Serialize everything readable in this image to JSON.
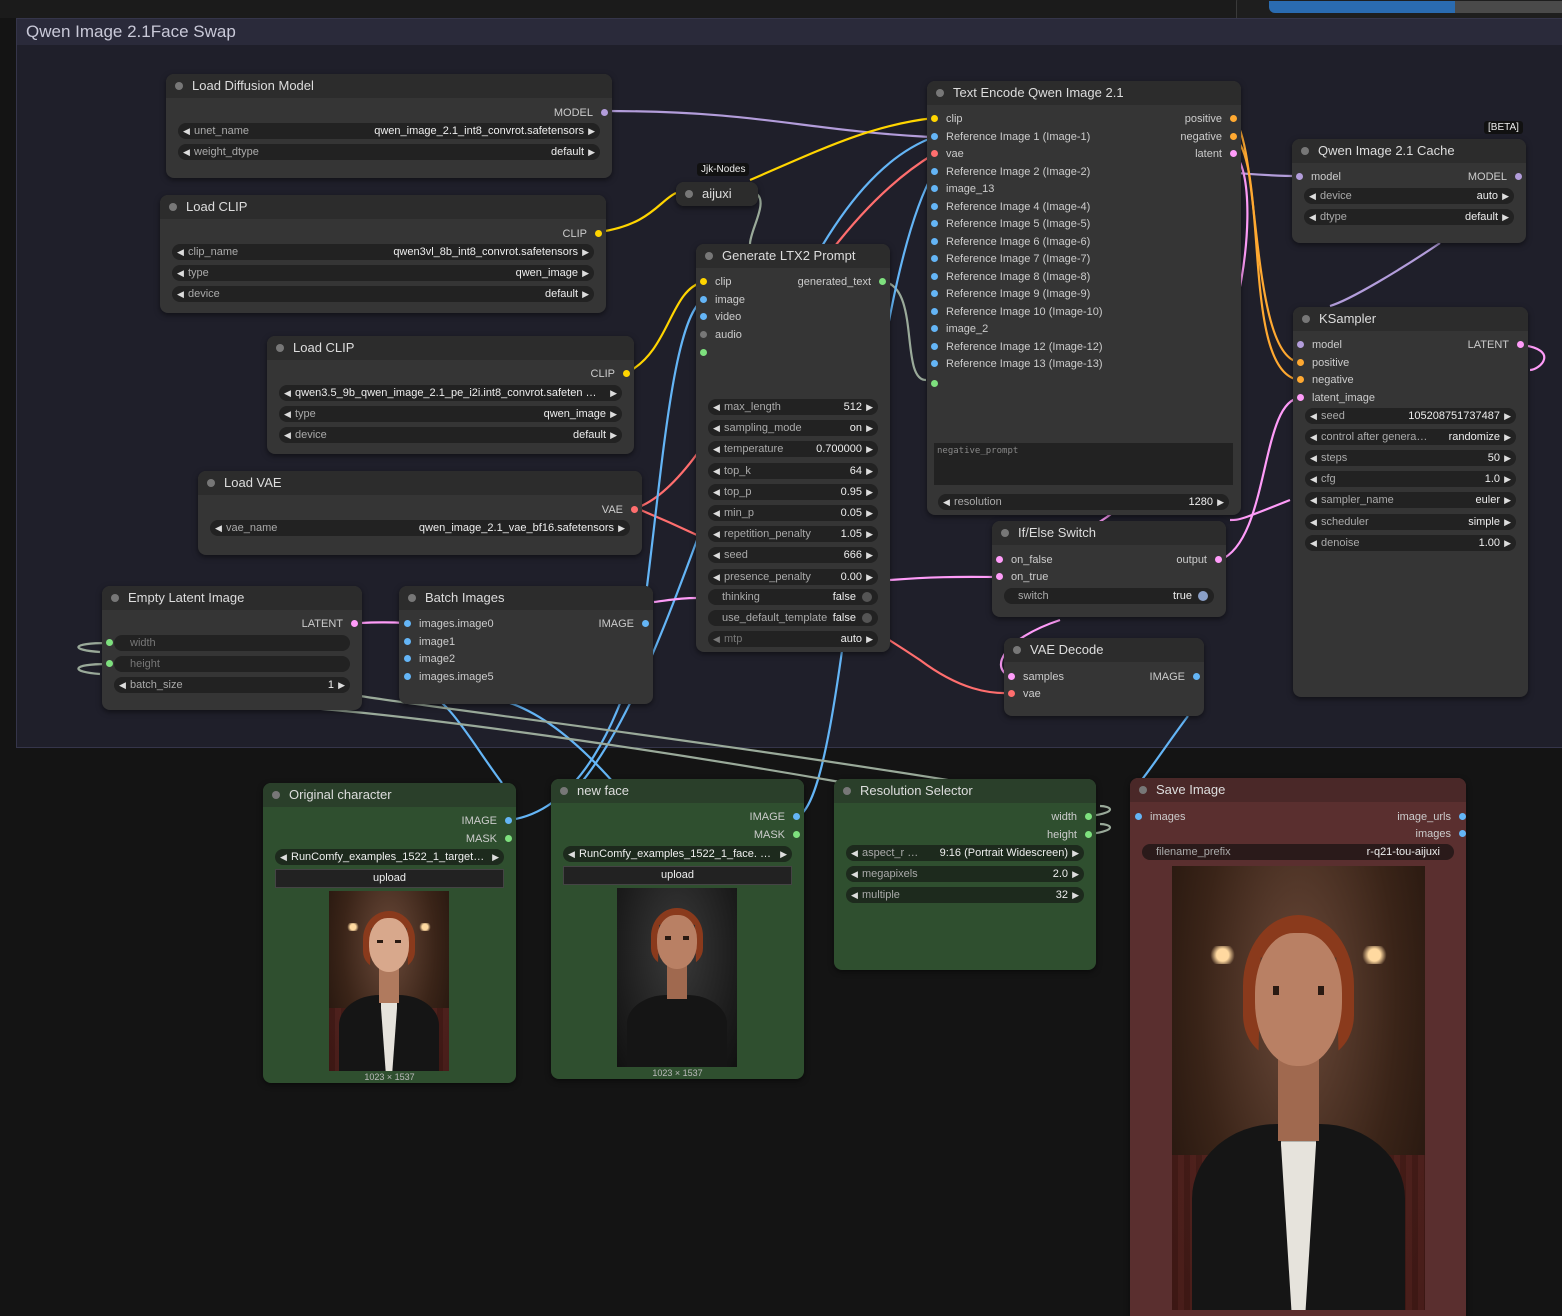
{
  "group": {
    "title": "Qwen Image 2.1Face Swap"
  },
  "badges": {
    "jjk": "Jjk-Nodes",
    "beta": "[BETA]"
  },
  "nodes": {
    "load_diffusion": {
      "title": "Load Diffusion Model",
      "out_model": "MODEL",
      "unet_name_label": "unet_name",
      "unet_name": "qwen_image_2.1_int8_convrot.safetensors",
      "weight_dtype_label": "weight_dtype",
      "weight_dtype": "default"
    },
    "load_clip1": {
      "title": "Load CLIP",
      "out_clip": "CLIP",
      "clip_name_label": "clip_name",
      "clip_name": "qwen3vl_8b_int8_convrot.safetensors",
      "type_label": "type",
      "type": "qwen_image",
      "device_label": "device",
      "device": "default"
    },
    "load_clip2": {
      "title": "Load CLIP",
      "out_clip": "CLIP",
      "clip_name": "qwen3.5_9b_qwen_image_2.1_pe_i2i.int8_convrot.safeten  …",
      "type_label": "type",
      "type": "qwen_image",
      "device_label": "device",
      "device": "default"
    },
    "load_vae": {
      "title": "Load VAE",
      "out_vae": "VAE",
      "vae_name_label": "vae_name",
      "vae_name": "qwen_image_2.1_vae_bf16.safetensors"
    },
    "empty_latent": {
      "title": "Empty Latent Image",
      "out_latent": "LATENT",
      "width_label": "width",
      "height_label": "height",
      "batch_label": "batch_size",
      "batch_size": "1"
    },
    "batch_images": {
      "title": "Batch Images",
      "out_image": "IMAGE",
      "inputs": [
        "images.image0",
        "image1",
        "image2",
        "images.image5"
      ]
    },
    "aijuxi": {
      "title": "aijuxi"
    },
    "ltx2": {
      "title": "Generate LTX2 Prompt",
      "out_text": "generated_text",
      "inputs": [
        "clip",
        "image",
        "video",
        "audio"
      ],
      "widgets": [
        {
          "label": "max_length",
          "value": "512"
        },
        {
          "label": "sampling_mode",
          "value": "on"
        },
        {
          "label": "temperature",
          "value": "0.700000"
        },
        {
          "label": "top_k",
          "value": "64"
        },
        {
          "label": "top_p",
          "value": "0.95"
        },
        {
          "label": "min_p",
          "value": "0.05"
        },
        {
          "label": "repetition_penalty",
          "value": "1.05"
        },
        {
          "label": "seed",
          "value": "666"
        },
        {
          "label": "presence_penalty",
          "value": "0.00"
        }
      ],
      "thinking_label": "thinking",
      "thinking": "false",
      "udt_label": "use_default_template",
      "udt": "false",
      "mtp_label": "mtp",
      "mtp": "auto"
    },
    "text_encode": {
      "title": "Text Encode Qwen Image 2.1",
      "inputs": [
        "clip",
        "Reference Image 1 (Image-1)",
        "vae",
        "Reference Image 2 (Image-2)",
        "image_13",
        "Reference Image 4 (Image-4)",
        "Reference Image 5 (Image-5)",
        "Reference Image 6 (Image-6)",
        "Reference Image 7 (Image-7)",
        "Reference Image 8 (Image-8)",
        "Reference Image 9 (Image-9)",
        "Reference Image 10 (Image-10)",
        "image_2",
        "Reference Image 12 (Image-12)",
        "Reference Image 13 (Image-13)"
      ],
      "outputs": [
        "positive",
        "negative",
        "latent"
      ],
      "negative_placeholder": "negative_prompt",
      "resolution_label": "resolution",
      "resolution": "1280"
    },
    "cache": {
      "title": "Qwen Image 2.1 Cache",
      "in_model": "model",
      "out_model": "MODEL",
      "device_label": "device",
      "device": "auto",
      "dtype_label": "dtype",
      "dtype": "default"
    },
    "ksampler": {
      "title": "KSampler",
      "inputs": [
        "model",
        "positive",
        "negative",
        "latent_image"
      ],
      "out_latent": "LATENT",
      "widgets": [
        {
          "label": "seed",
          "value": "105208751737487"
        },
        {
          "label": "control after genera…",
          "value": "randomize"
        },
        {
          "label": "steps",
          "value": "50"
        },
        {
          "label": "cfg",
          "value": "1.0"
        },
        {
          "label": "sampler_name",
          "value": "euler"
        },
        {
          "label": "scheduler",
          "value": "simple"
        },
        {
          "label": "denoise",
          "value": "1.00"
        }
      ]
    },
    "ifelse": {
      "title": "If/Else Switch",
      "inputs": [
        "on_false",
        "on_true"
      ],
      "out": "output",
      "switch_label": "switch",
      "switch": "true"
    },
    "vae_decode": {
      "title": "VAE Decode",
      "inputs": [
        "samples",
        "vae"
      ],
      "out": "IMAGE"
    },
    "original": {
      "title": "Original character",
      "outs": [
        "IMAGE",
        "MASK"
      ],
      "image": "RunComfy_examples_1522_1_target…",
      "upload": "upload",
      "dims": "1023 × 1537"
    },
    "newface": {
      "title": "new face",
      "outs": [
        "IMAGE",
        "MASK"
      ],
      "image": "RunComfy_examples_1522_1_face.  …",
      "upload": "upload",
      "dims": "1023 × 1537"
    },
    "resolution": {
      "title": "Resolution Selector",
      "outs": [
        "width",
        "height"
      ],
      "aspect_label": "aspect_r  …",
      "aspect": "9:16 (Portrait Widescreen)",
      "mp_label": "megapixels",
      "mp": "2.0",
      "mult_label": "multiple",
      "mult": "32"
    },
    "save": {
      "title": "Save Image",
      "in_images": "images",
      "outs": [
        "image_urls",
        "images"
      ],
      "prefix_label": "filename_prefix",
      "prefix": "r-q21-tou-aijuxi"
    }
  },
  "colors": {
    "model": "#b39ddb",
    "clip": "#ffd500",
    "vae": "#ff6e6e",
    "image": "#64b5f6",
    "latent": "#ff9cf9",
    "cond": "#ffa931",
    "int": "#7ee07e",
    "string": "#9aaa9a"
  }
}
